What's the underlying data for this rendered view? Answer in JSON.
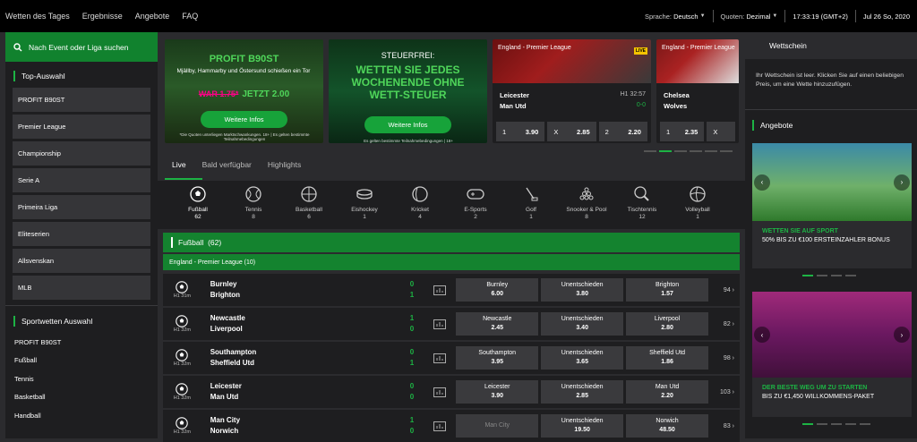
{
  "nav": [
    "Wetten des Tages",
    "Ergebnisse",
    "Angebote",
    "FAQ"
  ],
  "header": {
    "language_label": "Sprache:",
    "language_value": "Deutsch",
    "odds_label": "Quoten:",
    "odds_value": "Dezimal",
    "time": "17:33:19",
    "timezone": "(GMT+2)",
    "date": "Jul 26 So, 2020"
  },
  "sidebar": {
    "search_label": "Nach Event oder Liga suchen",
    "top_title": "Top-Auswahl",
    "top_items": [
      "PROFIT B90ST",
      "Premier League",
      "Championship",
      "Serie A",
      "Primeira Liga",
      "Eliteserien",
      "Allsvenskan",
      "MLB"
    ],
    "sports_title": "Sportwetten Auswahl",
    "sports_items": [
      "PROFIT B90ST",
      "Fußball",
      "Tennis",
      "Basketball",
      "Handball"
    ]
  },
  "banners": {
    "b1": {
      "title": "PROFIT B90ST",
      "text": "Mjällby, Hammarby und Östersund schießen ein Tor",
      "old_odds": "WAR 1.75*",
      "new_odds": "JETZT 2.00",
      "button": "Weitere Infos",
      "fine": "*Die Quoten unterliegen Marktschwankungen. 18+ | Es gelten bestimmte Teilnahmebedingungen"
    },
    "b2": {
      "title": "STEUERFREI:",
      "headline": "WETTEN SIE JEDES WOCHENENDE OHNE WETT-STEUER",
      "button": "Weitere Infos",
      "fine": "Es gelten bestimmte Teilnahmebedingungen | 18+"
    }
  },
  "match_cards": [
    {
      "league": "England - Premier League",
      "live": "LIVE",
      "team_a": "Leicester",
      "team_b": "Man Utd",
      "time": "H1 32:57",
      "score": "0-0",
      "odds": [
        {
          "label": "1",
          "value": "3.90"
        },
        {
          "label": "X",
          "value": "2.85"
        },
        {
          "label": "2",
          "value": "2.20"
        }
      ]
    },
    {
      "league": "England - Premier League",
      "team_a": "Chelsea",
      "team_b": "Wolves",
      "odds": [
        {
          "label": "1",
          "value": "2.35"
        },
        {
          "label": "X",
          "value": ""
        }
      ]
    }
  ],
  "tabs": [
    "Live",
    "Bald verfügbar",
    "Highlights"
  ],
  "sports": [
    {
      "name": "Fußball",
      "count": "62",
      "icon": "soccer-ball-icon"
    },
    {
      "name": "Tennis",
      "count": "8",
      "icon": "tennis-ball-icon"
    },
    {
      "name": "Basketball",
      "count": "6",
      "icon": "basketball-icon"
    },
    {
      "name": "Eishockey",
      "count": "1",
      "icon": "hockey-puck-icon"
    },
    {
      "name": "Kricket",
      "count": "4",
      "icon": "cricket-ball-icon"
    },
    {
      "name": "E-Sports",
      "count": "2",
      "icon": "gamepad-icon"
    },
    {
      "name": "Golf",
      "count": "1",
      "icon": "golf-icon"
    },
    {
      "name": "Snooker & Pool",
      "count": "8",
      "icon": "snooker-icon"
    },
    {
      "name": "Tischtennis",
      "count": "12",
      "icon": "table-tennis-icon"
    },
    {
      "name": "Volleyball",
      "count": "1",
      "icon": "volleyball-icon"
    }
  ],
  "section": {
    "title": "Fußball",
    "count": "(62)"
  },
  "league": "England - Premier League (10)",
  "matches": [
    {
      "time_a": "H1",
      "time_b": "31m",
      "home": "Burnley",
      "away": "Brighton",
      "score_home": "0",
      "score_away": "1",
      "o1": {
        "name": "Burnley",
        "value": "6.00"
      },
      "ox": {
        "name": "Unentschieden",
        "value": "3.80"
      },
      "o2": {
        "name": "Brighton",
        "value": "1.57"
      },
      "more": "94"
    },
    {
      "time_a": "H1",
      "time_b": "32m",
      "home": "Newcastle",
      "away": "Liverpool",
      "score_home": "1",
      "score_away": "0",
      "o1": {
        "name": "Newcastle",
        "value": "2.45"
      },
      "ox": {
        "name": "Unentschieden",
        "value": "3.40"
      },
      "o2": {
        "name": "Liverpool",
        "value": "2.80"
      },
      "more": "82"
    },
    {
      "time_a": "H1",
      "time_b": "32m",
      "home": "Southampton",
      "away": "Sheffield Utd",
      "score_home": "0",
      "score_away": "1",
      "o1": {
        "name": "Southampton",
        "value": "3.95"
      },
      "ox": {
        "name": "Unentschieden",
        "value": "3.65"
      },
      "o2": {
        "name": "Sheffield Utd",
        "value": "1.86"
      },
      "more": "98"
    },
    {
      "time_a": "H1",
      "time_b": "32m",
      "home": "Leicester",
      "away": "Man Utd",
      "score_home": "0",
      "score_away": "0",
      "o1": {
        "name": "Leicester",
        "value": "3.90"
      },
      "ox": {
        "name": "Unentschieden",
        "value": "2.85"
      },
      "o2": {
        "name": "Man Utd",
        "value": "2.20"
      },
      "more": "103"
    },
    {
      "time_a": "H1",
      "time_b": "32m",
      "home": "Man City",
      "away": "Norwich",
      "score_home": "1",
      "score_away": "0",
      "o1": {
        "name": "Man City",
        "value": ""
      },
      "ox": {
        "name": "Unentschieden",
        "value": "19.50"
      },
      "o2": {
        "name": "Norwich",
        "value": "48.50"
      },
      "more": "83"
    }
  ],
  "betslip": {
    "title": "Wettschein",
    "empty_text": "Ihr Wettschein ist leer. Klicken Sie auf einen beliebigen Preis, um eine Wette hinzuzufügen."
  },
  "offers": {
    "title": "Angebote",
    "promo1": {
      "title": "WETTEN SIE AUF SPORT",
      "sub": "50% BIS ZU €100 ERSTEINZAHLER BONUS"
    },
    "promo2": {
      "title": "DER BESTE WEG UM ZU STARTEN",
      "sub": "BIS ZU €1,450 WILLKOMMENS-PAKET"
    }
  },
  "colors": {
    "accent": "#1db344",
    "dark": "#1e1e20",
    "panel": "#2b2b2e"
  }
}
